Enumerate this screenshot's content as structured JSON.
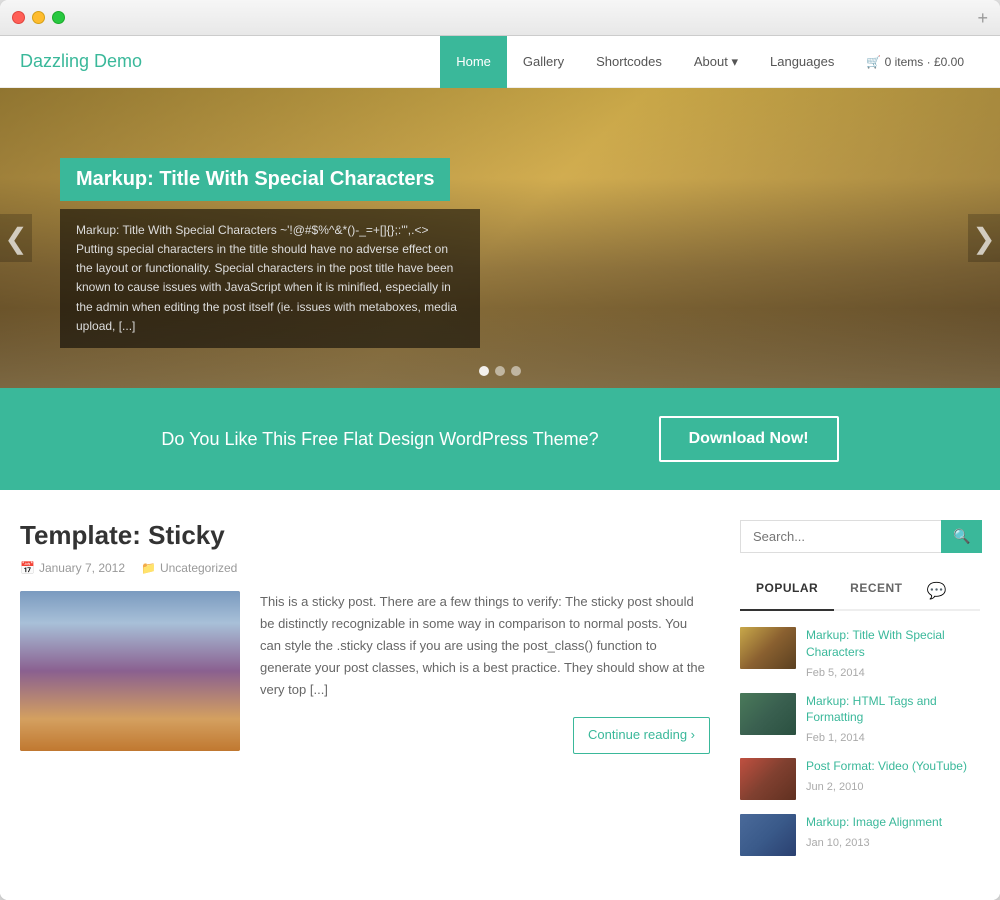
{
  "browser": {
    "plus_label": "+"
  },
  "header": {
    "logo": "Dazzling Demo",
    "nav": [
      {
        "id": "home",
        "label": "Home",
        "active": true
      },
      {
        "id": "gallery",
        "label": "Gallery",
        "active": false
      },
      {
        "id": "shortcodes",
        "label": "Shortcodes",
        "active": false
      },
      {
        "id": "about",
        "label": "About ▾",
        "active": false
      },
      {
        "id": "languages",
        "label": "Languages",
        "active": false
      }
    ],
    "cart": "🛒 0 items · £0.00"
  },
  "hero": {
    "title": "Markup: Title With Special Characters",
    "text": "Markup: Title With Special Characters ~'!@#$%^&*()-_=+[]{};:'\",.<> Putting special characters in the title should have no adverse effect on the layout or functionality. Special characters in the post title have been known to cause issues with JavaScript when it is minified, especially in the admin when editing the post itself (ie. issues with metaboxes, media upload, [...]",
    "arrow_left": "❮",
    "arrow_right": "❯",
    "dots": [
      {
        "active": true
      },
      {
        "active": false
      },
      {
        "active": false
      }
    ]
  },
  "cta": {
    "text": "Do You Like This Free Flat Design WordPress Theme?",
    "button": "Download Now!"
  },
  "post": {
    "title": "Template: Sticky",
    "meta_date_icon": "📅",
    "meta_date": "January 7, 2012",
    "meta_cat_icon": "📁",
    "meta_cat": "Uncategorized",
    "excerpt": "This is a sticky post. There are a few things to verify: The sticky post should be distinctly recognizable in some way in comparison to normal posts. You can style the .sticky class if you are using the post_class() function to generate your post classes, which is a best practice. They should show at the very top [...]",
    "continue": "Continue reading ›"
  },
  "sidebar": {
    "search_placeholder": "Search...",
    "search_btn_icon": "🔍",
    "tabs": [
      {
        "id": "popular",
        "label": "POPULAR",
        "active": true
      },
      {
        "id": "recent",
        "label": "RECENT",
        "active": false
      },
      {
        "id": "chat",
        "label": "💬",
        "active": false
      }
    ],
    "items": [
      {
        "id": 1,
        "thumb_class": "wt-1",
        "title": "Markup: Title With Special Characters",
        "date": "Feb 5, 2014"
      },
      {
        "id": 2,
        "thumb_class": "wt-2",
        "title": "Markup: HTML Tags and Formatting",
        "date": "Feb 1, 2014"
      },
      {
        "id": 3,
        "thumb_class": "wt-3",
        "title": "Post Format: Video (YouTube)",
        "date": "Jun 2, 2010"
      },
      {
        "id": 4,
        "thumb_class": "wt-4",
        "title": "Markup: Image Alignment",
        "date": "Jan 10, 2013"
      }
    ]
  }
}
